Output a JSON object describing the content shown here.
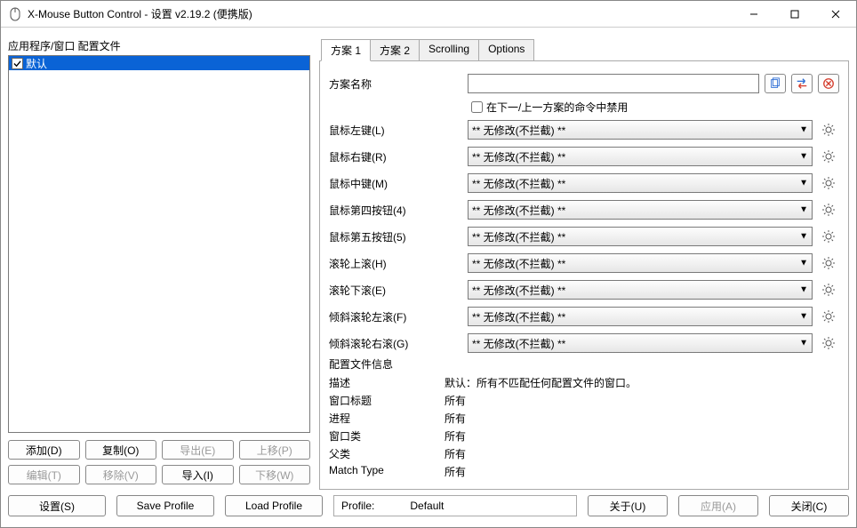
{
  "window": {
    "title": "X-Mouse Button Control - 设置 v2.19.2 (便携版)"
  },
  "left": {
    "heading": "应用程序/窗口 配置文件",
    "items": [
      {
        "label": "默认",
        "checked": true,
        "selected": true
      }
    ],
    "buttons": {
      "add": "添加(D)",
      "copy": "复制(O)",
      "export": "导出(E)",
      "moveup": "上移(P)",
      "edit": "编辑(T)",
      "remove": "移除(V)",
      "import": "导入(I)",
      "movedown": "下移(W)"
    }
  },
  "tabs": {
    "t1": "方案 1",
    "t2": "方案 2",
    "t3": "Scrolling",
    "t4": "Options"
  },
  "layer": {
    "nameLabel": "方案名称",
    "nameValue": "",
    "disableLabel": "在下一/上一方案的命令中禁用",
    "rows": {
      "l": "鼠标左键(L)",
      "r": "鼠标右键(R)",
      "m": "鼠标中键(M)",
      "x4": "鼠标第四按钮(4)",
      "x5": "鼠标第五按钮(5)",
      "wu": "滚轮上滚(H)",
      "wd": "滚轮下滚(E)",
      "tl": "倾斜滚轮左滚(F)",
      "tr": "倾斜滚轮右滚(G)"
    },
    "value": "** 无修改(不拦截) **"
  },
  "profinfo": {
    "title": "配置文件信息",
    "desc_lbl": "描述",
    "desc_val": "默认：所有不匹配任何配置文件的窗口。",
    "caption_lbl": "窗口标题",
    "proc_lbl": "进程",
    "class_lbl": "窗口类",
    "parent_lbl": "父类",
    "match_lbl": "Match Type",
    "all": "所有"
  },
  "footer": {
    "settings": "设置(S)",
    "save": "Save Profile",
    "load": "Load Profile",
    "profile_lbl": "Profile:",
    "profile_val": "Default",
    "about": "关于(U)",
    "apply": "应用(A)",
    "close": "关闭(C)"
  }
}
